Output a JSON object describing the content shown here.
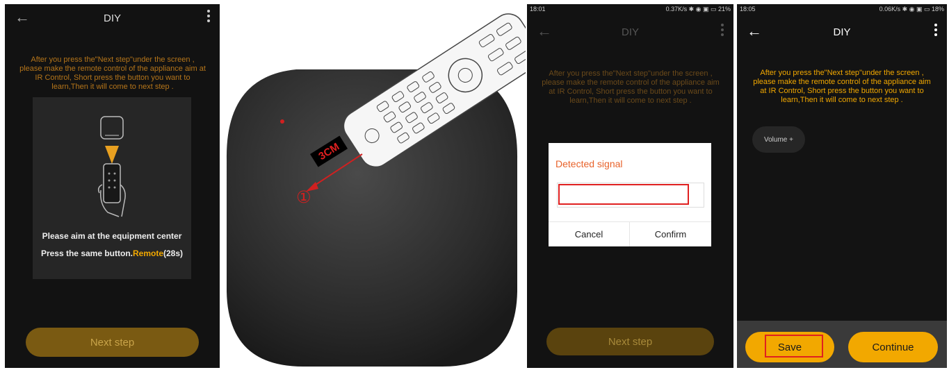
{
  "panel1": {
    "title": "DIY",
    "instruction": "After you press the\"Next step\"under the screen , please make the remote control of the appliance aim at IR Control, Short press the button you want to learn,Then it  will come to next step .",
    "aim_text": "Please aim at the equipment center",
    "press_prefix": "Press the same button.",
    "press_remote": "Remote",
    "press_count": "(28s)",
    "next_label": "Next step"
  },
  "panel2": {
    "distance_label": "3CM",
    "step_marker": "①"
  },
  "panel3": {
    "time": "18:01",
    "status_right": "0.37K/s ✱ ◉ ▣ ▭ 21%",
    "title": "DIY",
    "instruction": "After you press the\"Next step\"under the screen , please make the remote control of the appliance aim at IR Control, Short press the button you want to learn,Then it  will come to next step .",
    "dialog_title": "Detected signal",
    "dialog_input_value": "",
    "cancel_label": "Cancel",
    "confirm_label": "Confirm",
    "next_label": "Next step"
  },
  "panel4": {
    "time": "18:05",
    "status_right": "0.06K/s ✱ ◉ ▣ ▭ 18%",
    "title": "DIY",
    "instruction": "After you press the\"Next step\"under the screen , please make the remote control of the appliance aim at IR Control, Short press the button you want to learn,Then it  will come to next step .",
    "chip_label": "Volume +",
    "save_label": "Save",
    "continue_label": "Continue"
  },
  "colors": {
    "accent_orange": "#f2a800",
    "dim_gold": "#7a5a12",
    "instruction_orange": "#e8912a",
    "dialog_title": "#e8622a",
    "highlight_red": "#e02020"
  },
  "icons": [
    "back-arrow-icon",
    "more-vert-icon",
    "ir-hub-icon",
    "hand-remote-icon",
    "signal-arrow-icon"
  ]
}
